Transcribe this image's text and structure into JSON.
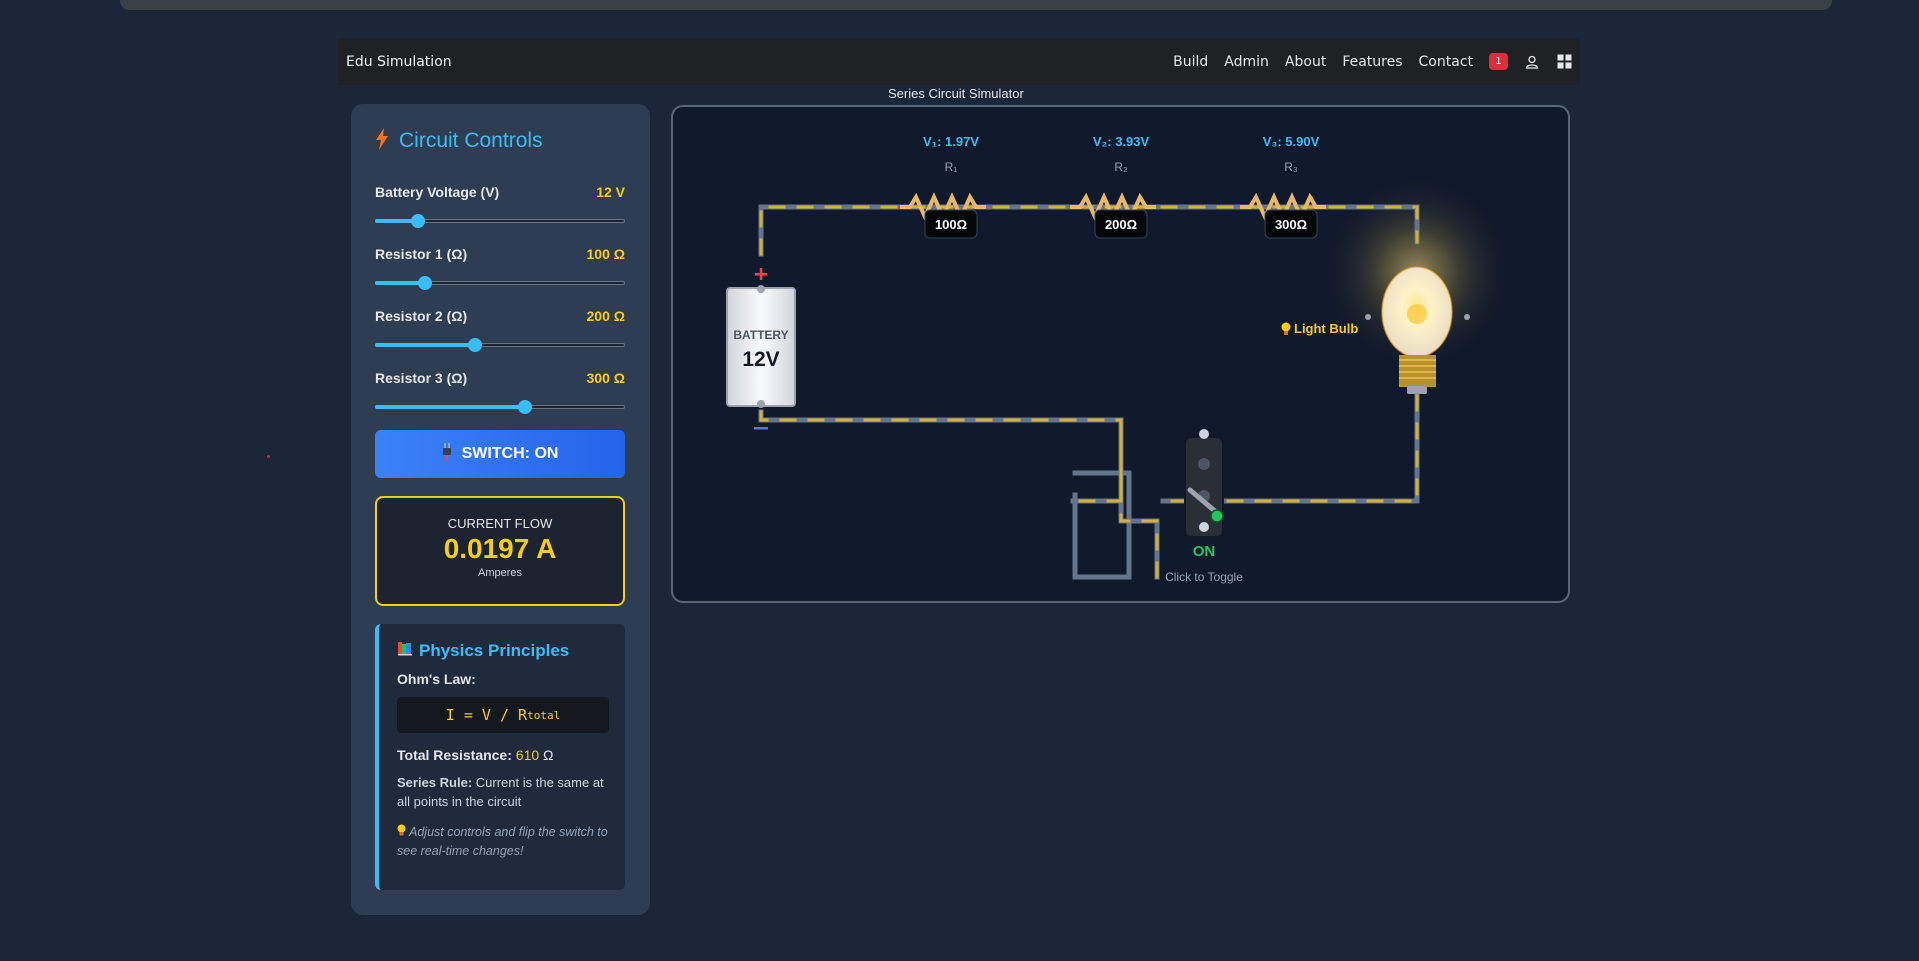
{
  "navbar": {
    "brand": "Edu Simulation",
    "links": [
      "Build",
      "Admin",
      "About",
      "Features",
      "Contact"
    ],
    "notification_count": "1"
  },
  "simulator_title": "Series Circuit Simulator",
  "controls": {
    "title": "Circuit Controls",
    "battery": {
      "label": "Battery Voltage (V)",
      "value": "12 V",
      "level": 0.17
    },
    "r1": {
      "label": "Resistor 1 (Ω)",
      "value": "100 Ω",
      "level": 0.2
    },
    "r2": {
      "label": "Resistor 2 (Ω)",
      "value": "200 Ω",
      "level": 0.4
    },
    "r3": {
      "label": "Resistor 3 (Ω)",
      "value": "300 Ω",
      "level": 0.6
    },
    "switch_label": "SWITCH: ON"
  },
  "current": {
    "caption": "CURRENT FLOW",
    "value": "0.0197 A",
    "unit": "Amperes"
  },
  "physics": {
    "title": "Physics Principles",
    "ohms_law_label": "Ohm's Law:",
    "formula_main": "I = V / R",
    "formula_sub": "total",
    "total_label": "Total Resistance:",
    "total_value": "610",
    "total_unit": "Ω",
    "series_rule_label": "Series Rule:",
    "series_rule_text": "Current is the same at all points in the circuit",
    "tip": "Adjust controls and flip the switch to see real-time changes!"
  },
  "circuit": {
    "resistors": [
      {
        "voltage_label": "V₁: 1.97V",
        "name": "R₁",
        "value": "100Ω"
      },
      {
        "voltage_label": "V₂: 3.93V",
        "name": "R₂",
        "value": "200Ω"
      },
      {
        "voltage_label": "V₃: 5.90V",
        "name": "R₃",
        "value": "300Ω"
      }
    ],
    "battery_label": "BATTERY",
    "battery_voltage": "12V",
    "bulb_label": "Light Bulb",
    "switch_state": "ON",
    "switch_hint": "Click to Toggle"
  },
  "colors": {
    "accent": "#38bdf8",
    "highlight": "#facc15",
    "button": "#3b82f6",
    "switch_on": "#22c55e"
  }
}
